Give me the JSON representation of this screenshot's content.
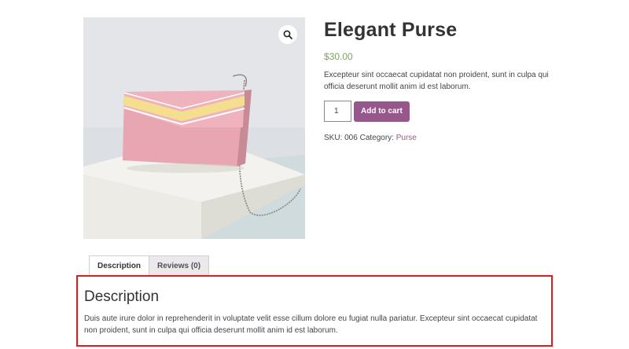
{
  "product": {
    "title": "Elegant Purse",
    "price": "$30.00",
    "short_description": "Excepteur sint occaecat cupidatat non proident, sunt in culpa qui officia deserunt mollit anim id est laborum.",
    "quantity": "1",
    "add_to_cart_label": "Add to cart",
    "meta": {
      "sku_label": "SKU:",
      "sku": "006",
      "category_label": "Category:",
      "category": "Purse"
    },
    "image_icon": "zoom-magnifier-icon"
  },
  "tabs": [
    {
      "label": "Description",
      "active": true
    },
    {
      "label": "Reviews (0)",
      "active": false
    }
  ],
  "description_panel": {
    "heading": "Description",
    "body": "Duis aute irure dolor in reprehenderit in voluptate velit esse cillum dolore eu fugiat nulla pariatur. Excepteur sint occaecat cupidatat non proident, sunt in culpa qui officia deserunt mollit anim id est laborum."
  },
  "colors": {
    "accent": "#96588a",
    "price": "#7ea35b",
    "highlight_border": "#e01b1b",
    "purse_pink": "#e9a6b2",
    "purse_stripe": "#f3df8e"
  }
}
